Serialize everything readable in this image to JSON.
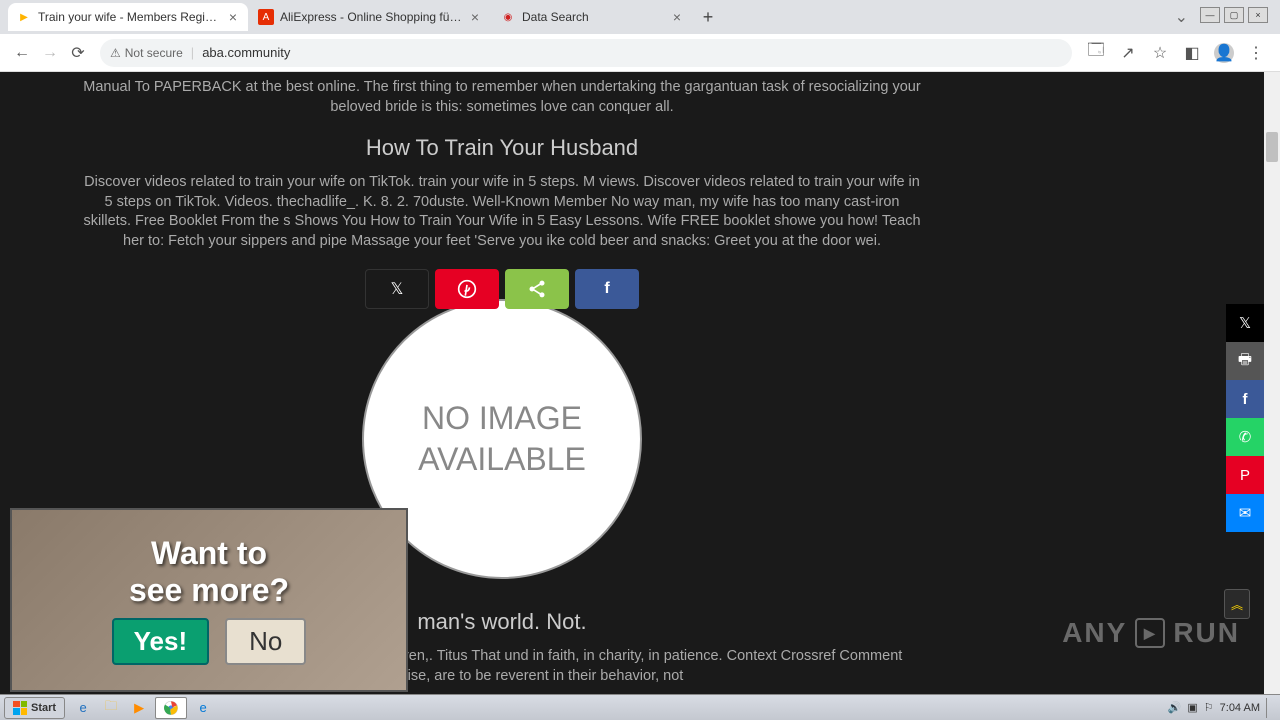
{
  "tabs": [
    {
      "title": "Train your wife - Members Registered",
      "favicon_color": "#ffb400"
    },
    {
      "title": "AliExpress - Online Shopping für Ele",
      "favicon_color": "#e62e04"
    },
    {
      "title": "Data Search",
      "favicon_color": "#d02020"
    }
  ],
  "address_bar": {
    "not_secure": "Not secure",
    "url": "aba.community"
  },
  "article": {
    "p0": "Manual To PAPERBACK at the best online. The first thing to remember when undertaking the gargantuan task of resocializing your beloved bride is this: sometimes love can conquer all.",
    "h1": "How To Train Your Husband",
    "p1": "Discover videos related to train your wife on TikTok. train your wife in 5 steps. M views. Discover videos related to train your wife in 5 steps on TikTok. Videos. thechadlife_. K. 8. 2. 70duste. Well-Known Member No way man, my wife has too many cast-iron skillets. Free Booklet From the s Shows You How to Train Your Wife in 5 Easy Lessons. Wife FREE booklet showe you how! Teach her to: Fetch your sippers and pipe Massage your feet 'Serve you ike cold beer and snacks: Greet you at the door wei.",
    "no_image": "NO IMAGE\nAVAILABLE",
    "h2": "man's world. Not.",
    "p2": "sober, to love their husbands, to love their children,. Titus That und in faith, in charity, in patience. Context Crossref Comment women, likewise, are to be reverent in their behavior, not"
  },
  "popup": {
    "line1": "Want to",
    "line2": "see more?",
    "yes": "Yes!",
    "no": "No"
  },
  "watermark": {
    "text1": "ANY",
    "text2": "RUN"
  },
  "taskbar": {
    "start": "Start",
    "time": "7:04 AM"
  }
}
